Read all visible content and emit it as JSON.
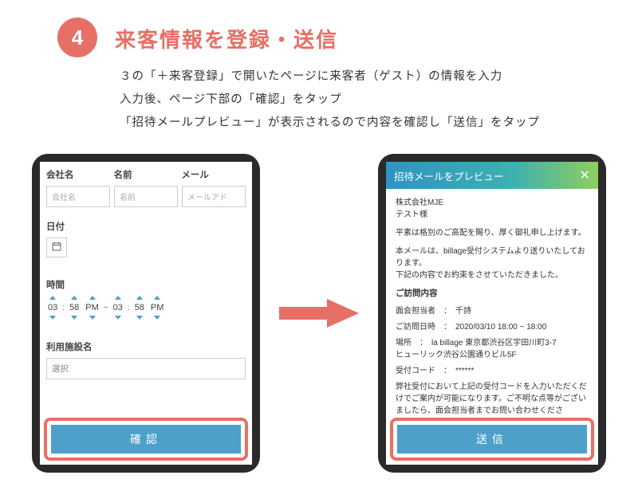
{
  "step": {
    "number": "4",
    "title": "来客情報を登録・送信"
  },
  "description": {
    "line1": "３の「＋来客登録」で開いたページに来客者（ゲスト）の情報を入力",
    "line2": "入力後、ページ下部の「確認」をタップ",
    "line3": "「招待メールプレビュー」が表示されるので内容を確認し「送信」をタップ"
  },
  "form": {
    "headers": {
      "company": "会社名",
      "name": "名前",
      "mail": "メール"
    },
    "placeholders": {
      "company": "会社名",
      "name": "名前",
      "mail": "メールアド"
    },
    "date_label": "日付",
    "time_label": "時間",
    "time": {
      "h1": "03",
      "m1": "58",
      "ap1": "PM",
      "sep": "~",
      "h2": "03",
      "m2": "58",
      "ap2": "PM",
      "colon": ":"
    },
    "facility_label": "利用施設名",
    "facility_placeholder": "選択",
    "confirm": "確認"
  },
  "preview": {
    "bar_title": "招待メールをプレビュー",
    "close": "✕",
    "company": "株式会社MJE",
    "person": "テスト様",
    "greeting": "平素は格別のご高配を賜り、厚く御礼申し上げます。",
    "sys1": "本メールは、billage受付システムより送りいたしております。",
    "sys2": "下記の内容でお約束をさせていただきました。",
    "visit_heading": "ご訪問内容",
    "row_person": "面会担当者　：　千詩",
    "row_datetime": "ご訪問日時　：　2020/03/10 18:00 ~ 18:00",
    "row_place1": "場所　：　la billage 東京都渋谷区宇田川町3-7",
    "row_place2": "ヒューリック渋谷公園通りビル5F",
    "row_code": "受付コード　：　******",
    "footer": "弊社受付において上記の受付コードを入力いただくだけでご案内が可能になります。ご不明な点等がございましたら、面会担当者までお問い合わせくださ",
    "send": "送信"
  }
}
